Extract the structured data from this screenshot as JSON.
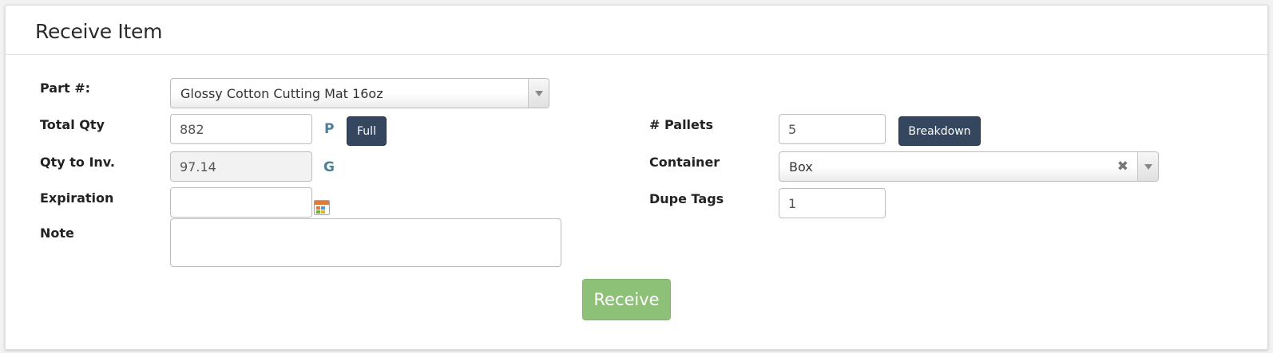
{
  "panel": {
    "title": "Receive Item"
  },
  "form": {
    "part": {
      "label": "Part #:",
      "value": "Glossy Cotton Cutting Mat 16oz"
    },
    "total_qty": {
      "label": "Total Qty",
      "value": "882",
      "unit": "P",
      "full_button": "Full"
    },
    "qty_to_inv": {
      "label": "Qty to Inv.",
      "value": "97.14",
      "unit": "G"
    },
    "expiration": {
      "label": "Expiration",
      "value": ""
    },
    "note": {
      "label": "Note",
      "value": ""
    },
    "pallets": {
      "label": "# Pallets",
      "value": "5",
      "breakdown_button": "Breakdown"
    },
    "container": {
      "label": "Container",
      "value": "Box",
      "clear_symbol": "✖"
    },
    "dupe_tags": {
      "label": "Dupe Tags",
      "value": "1"
    },
    "receive_button": "Receive"
  },
  "icons": {
    "calendar": "calendar-icon",
    "dropdown": "chevron-down-icon",
    "clear": "close-icon"
  },
  "colors": {
    "dark_button": "#34475f",
    "receive_button": "#8dc177",
    "unit_letter": "#4e7f96"
  }
}
